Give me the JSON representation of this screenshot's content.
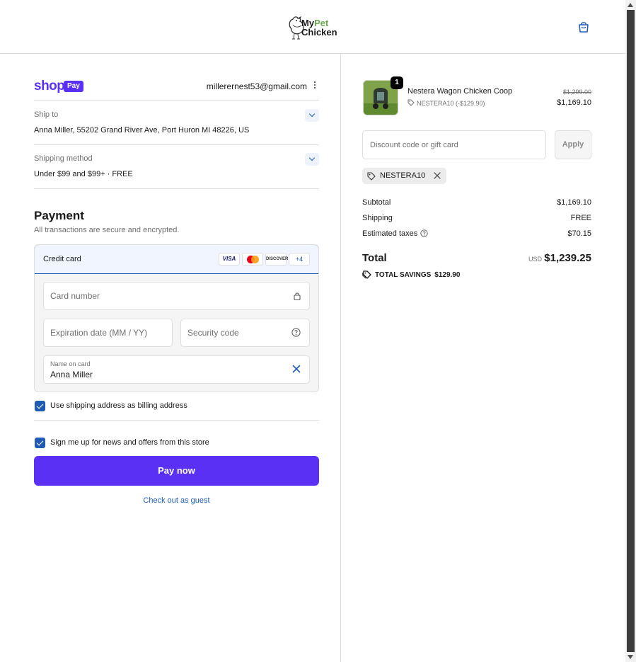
{
  "header": {
    "logo_my": "My",
    "logo_pet": "Pet",
    "logo_chicken": "Chicken"
  },
  "account": {
    "shop_word": "shop",
    "pay_badge": "Pay",
    "email": "millerernest53@gmail.com"
  },
  "ship_to": {
    "label": "Ship to",
    "value": "Anna Miller, 55202 Grand River Ave, Port Huron MI 48226, US"
  },
  "shipping_method": {
    "label": "Shipping method",
    "value": "Under $99 and $99+ · FREE"
  },
  "payment": {
    "title": "Payment",
    "subtitle": "All transactions are secure and encrypted.",
    "method_label": "Credit card",
    "card_logos": {
      "visa": "VISA",
      "discover": "DISCOVER",
      "more": "+4"
    },
    "card_number_placeholder": "Card number",
    "expiration_placeholder": "Expiration date (MM / YY)",
    "security_placeholder": "Security code",
    "name_label": "Name on card",
    "name_value": "Anna Miller",
    "billing_checkbox_label": "Use shipping address as billing address",
    "news_checkbox_label": "Sign me up for news and offers from this store",
    "pay_button": "Pay now",
    "guest_link": "Check out as guest"
  },
  "order": {
    "product": {
      "quantity": "1",
      "name": "Nestera Wagon Chicken Coop",
      "discount_line": "NESTERA10 (-$129.90)",
      "price_original": "$1,299.00",
      "price_final": "$1,169.10"
    },
    "discount_placeholder": "Discount code or gift card",
    "apply_button": "Apply",
    "applied_code": "NESTERA10",
    "subtotal_label": "Subtotal",
    "subtotal_value": "$1,169.10",
    "shipping_label": "Shipping",
    "shipping_value": "FREE",
    "taxes_label": "Estimated taxes",
    "taxes_value": "$70.15",
    "total_label": "Total",
    "total_currency": "USD",
    "total_value": "$1,239.25",
    "savings_label": "TOTAL SAVINGS",
    "savings_value": "$129.90"
  },
  "colors": {
    "shop_pay_purple": "#5a31f4",
    "link_blue": "#1f5bb5",
    "logo_green": "#6aa84f"
  }
}
